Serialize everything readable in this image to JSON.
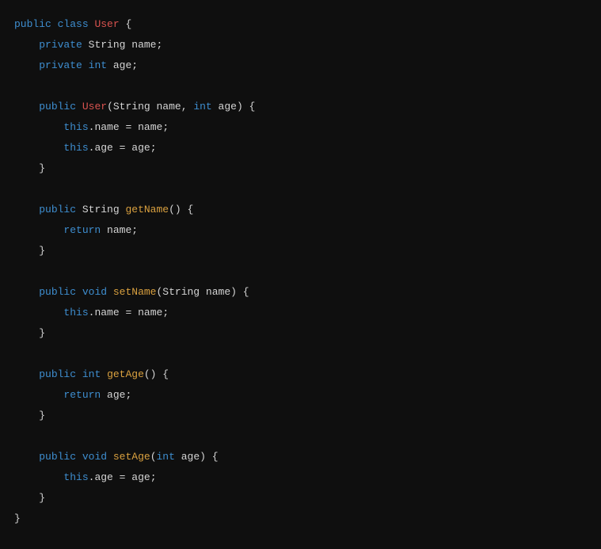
{
  "code": {
    "tokens": [
      [
        [
          "kw",
          "public"
        ],
        [
          "sp",
          " "
        ],
        [
          "kw",
          "class"
        ],
        [
          "sp",
          " "
        ],
        [
          "cls",
          "User"
        ],
        [
          "sp",
          " "
        ],
        [
          "pn",
          "{"
        ]
      ],
      [
        [
          "indent",
          1
        ],
        [
          "kw",
          "private"
        ],
        [
          "sp",
          " "
        ],
        [
          "type",
          "String"
        ],
        [
          "sp",
          " "
        ],
        [
          "var",
          "name"
        ],
        [
          "pn",
          ";"
        ]
      ],
      [
        [
          "indent",
          1
        ],
        [
          "kw",
          "private"
        ],
        [
          "sp",
          " "
        ],
        [
          "kw",
          "int"
        ],
        [
          "sp",
          " "
        ],
        [
          "var",
          "age"
        ],
        [
          "pn",
          ";"
        ]
      ],
      [],
      [
        [
          "indent",
          1
        ],
        [
          "kw",
          "public"
        ],
        [
          "sp",
          " "
        ],
        [
          "cls",
          "User"
        ],
        [
          "pn",
          "("
        ],
        [
          "type",
          "String"
        ],
        [
          "sp",
          " "
        ],
        [
          "var",
          "name"
        ],
        [
          "pn",
          ", "
        ],
        [
          "kw",
          "int"
        ],
        [
          "sp",
          " "
        ],
        [
          "var",
          "age"
        ],
        [
          "pn",
          ") {"
        ]
      ],
      [
        [
          "indent",
          2
        ],
        [
          "kw",
          "this"
        ],
        [
          "pn",
          "."
        ],
        [
          "var",
          "name"
        ],
        [
          "sp",
          " "
        ],
        [
          "pn",
          "="
        ],
        [
          "sp",
          " "
        ],
        [
          "var",
          "name"
        ],
        [
          "pn",
          ";"
        ]
      ],
      [
        [
          "indent",
          2
        ],
        [
          "kw",
          "this"
        ],
        [
          "pn",
          "."
        ],
        [
          "var",
          "age"
        ],
        [
          "sp",
          " "
        ],
        [
          "pn",
          "="
        ],
        [
          "sp",
          " "
        ],
        [
          "var",
          "age"
        ],
        [
          "pn",
          ";"
        ]
      ],
      [
        [
          "indent",
          1
        ],
        [
          "pn",
          "}"
        ]
      ],
      [],
      [
        [
          "indent",
          1
        ],
        [
          "kw",
          "public"
        ],
        [
          "sp",
          " "
        ],
        [
          "type",
          "String"
        ],
        [
          "sp",
          " "
        ],
        [
          "method",
          "getName"
        ],
        [
          "pn",
          "() {"
        ]
      ],
      [
        [
          "indent",
          2
        ],
        [
          "kw",
          "return"
        ],
        [
          "sp",
          " "
        ],
        [
          "var",
          "name"
        ],
        [
          "pn",
          ";"
        ]
      ],
      [
        [
          "indent",
          1
        ],
        [
          "pn",
          "}"
        ]
      ],
      [],
      [
        [
          "indent",
          1
        ],
        [
          "kw",
          "public"
        ],
        [
          "sp",
          " "
        ],
        [
          "kw",
          "void"
        ],
        [
          "sp",
          " "
        ],
        [
          "method",
          "setName"
        ],
        [
          "pn",
          "("
        ],
        [
          "type",
          "String"
        ],
        [
          "sp",
          " "
        ],
        [
          "var",
          "name"
        ],
        [
          "pn",
          ") {"
        ]
      ],
      [
        [
          "indent",
          2
        ],
        [
          "kw",
          "this"
        ],
        [
          "pn",
          "."
        ],
        [
          "var",
          "name"
        ],
        [
          "sp",
          " "
        ],
        [
          "pn",
          "="
        ],
        [
          "sp",
          " "
        ],
        [
          "var",
          "name"
        ],
        [
          "pn",
          ";"
        ]
      ],
      [
        [
          "indent",
          1
        ],
        [
          "pn",
          "}"
        ]
      ],
      [],
      [
        [
          "indent",
          1
        ],
        [
          "kw",
          "public"
        ],
        [
          "sp",
          " "
        ],
        [
          "kw",
          "int"
        ],
        [
          "sp",
          " "
        ],
        [
          "method",
          "getAge"
        ],
        [
          "pn",
          "() {"
        ]
      ],
      [
        [
          "indent",
          2
        ],
        [
          "kw",
          "return"
        ],
        [
          "sp",
          " "
        ],
        [
          "var",
          "age"
        ],
        [
          "pn",
          ";"
        ]
      ],
      [
        [
          "indent",
          1
        ],
        [
          "pn",
          "}"
        ]
      ],
      [],
      [
        [
          "indent",
          1
        ],
        [
          "kw",
          "public"
        ],
        [
          "sp",
          " "
        ],
        [
          "kw",
          "void"
        ],
        [
          "sp",
          " "
        ],
        [
          "method",
          "setAge"
        ],
        [
          "pn",
          "("
        ],
        [
          "kw",
          "int"
        ],
        [
          "sp",
          " "
        ],
        [
          "var",
          "age"
        ],
        [
          "pn",
          ") {"
        ]
      ],
      [
        [
          "indent",
          2
        ],
        [
          "kw",
          "this"
        ],
        [
          "pn",
          "."
        ],
        [
          "var",
          "age"
        ],
        [
          "sp",
          " "
        ],
        [
          "pn",
          "="
        ],
        [
          "sp",
          " "
        ],
        [
          "var",
          "age"
        ],
        [
          "pn",
          ";"
        ]
      ],
      [
        [
          "indent",
          1
        ],
        [
          "pn",
          "}"
        ]
      ],
      [
        [
          "pn",
          "}"
        ]
      ]
    ],
    "indent_unit": "    "
  }
}
